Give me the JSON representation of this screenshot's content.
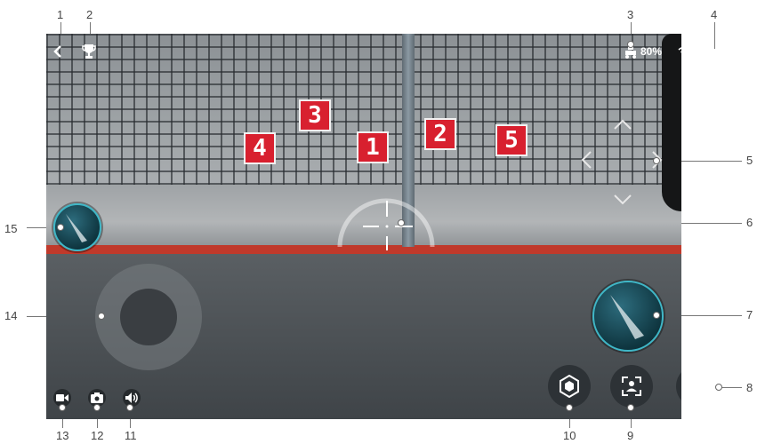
{
  "callouts": [
    "1",
    "2",
    "3",
    "4",
    "5",
    "6",
    "7",
    "8",
    "9",
    "10",
    "11",
    "12",
    "13",
    "14",
    "15"
  ],
  "status": {
    "battery": "80%"
  },
  "markers": [
    "4",
    "3",
    "1",
    "2",
    "5"
  ],
  "icons": {
    "back": "chevron-left-icon",
    "trophy": "trophy-icon",
    "robot": "robot-status-icon",
    "wifi": "wifi-icon",
    "settings": "gear-icon"
  },
  "colors": {
    "accent": "#3fb7c7",
    "marker": "#d8202f",
    "curb": "#c0392b"
  }
}
